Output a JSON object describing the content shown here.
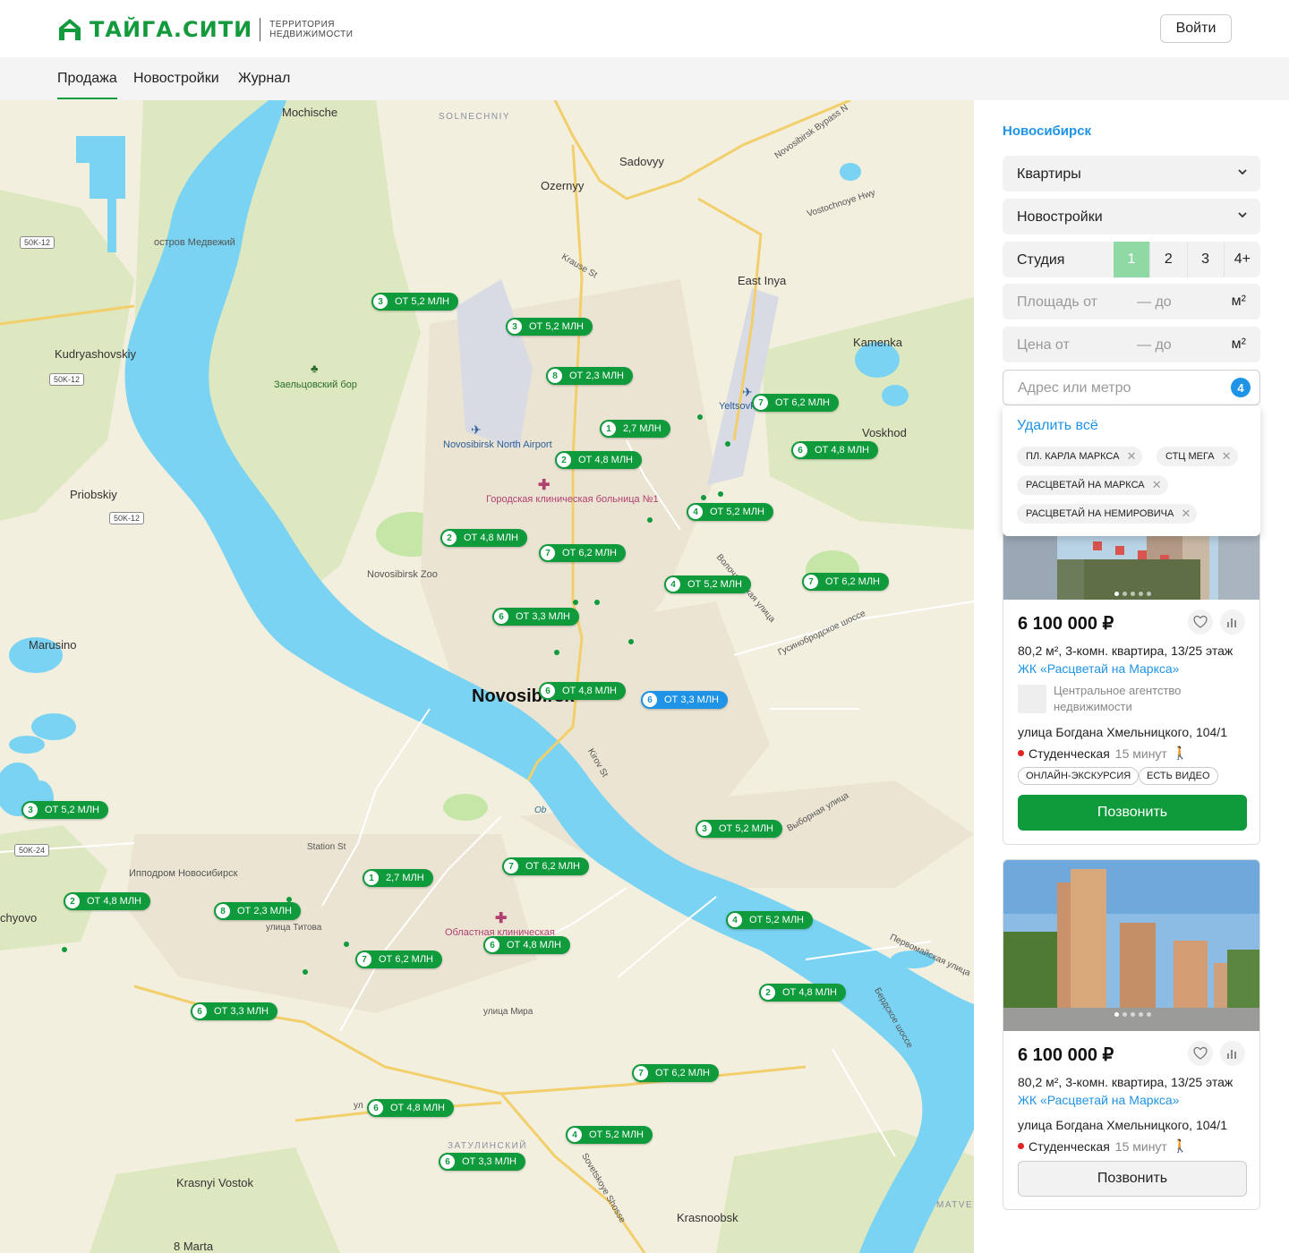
{
  "brand": {
    "name": "ТАЙГА.СИТИ",
    "tagline_1": "ТЕРРИТОРИЯ",
    "tagline_2": "НЕДВИЖИМОСТИ",
    "color": "#129a3c"
  },
  "header": {
    "login_label": "Войти"
  },
  "nav": {
    "items": [
      {
        "label": "Продажа",
        "active": true
      },
      {
        "label": "Новостройки"
      },
      {
        "label": "Журнал"
      }
    ]
  },
  "map": {
    "city_label": "Novosibirsk",
    "places": [
      "Mochische",
      "SOLNECHNIY",
      "Sadovyy",
      "Ozernyy",
      "East Inya",
      "Kamenka",
      "Kudryashovskiy",
      "остров Медвежий",
      "Заельцовский бор",
      "Novosibirsk North Airport",
      "Городская клиническая больница №1",
      "Yeltsovka Aerodrome",
      "Voskhod",
      "Priobskiy",
      "Novosibirsk Zoo",
      "Marusino",
      "Ob",
      "Station St",
      "Ипподром Новосибирск",
      "улица Титова",
      "Областная клиническая",
      "chyovo",
      "улица Мира",
      "ЗАТУЛИНСКИЙ",
      "Krasnyi Vostok",
      "Krasnoobsk",
      "8 Marta",
      "MATVEYEV",
      "Krause St",
      "Vostochnoye Hwy",
      "Novosibirsk Bypass N",
      "Волочаевская улица",
      "Гусинобродское шоссе",
      "Kirov St",
      "Выборная улица",
      "Первомайская улица",
      "Бердское шоссе",
      "Sovetskoye Shosse",
      "ул"
    ],
    "shields": [
      "50K-12",
      "50K-12",
      "50K-12",
      "50K-24"
    ],
    "pins": [
      {
        "n": "3",
        "label": "ОТ 5,2 МЛН"
      },
      {
        "n": "3",
        "label": "ОТ 5,2 МЛН"
      },
      {
        "n": "8",
        "label": "ОТ 2,3 МЛН"
      },
      {
        "n": "7",
        "label": "ОТ 6,2 МЛН"
      },
      {
        "n": "1",
        "label": "2,7 МЛН"
      },
      {
        "n": "6",
        "label": "ОТ 4,8 МЛН"
      },
      {
        "n": "2",
        "label": "ОТ 4,8 МЛН"
      },
      {
        "n": "4",
        "label": "ОТ 5,2 МЛН"
      },
      {
        "n": "2",
        "label": "ОТ 4,8 МЛН"
      },
      {
        "n": "7",
        "label": "ОТ 6,2 МЛН"
      },
      {
        "n": "4",
        "label": "ОТ 5,2 МЛН"
      },
      {
        "n": "7",
        "label": "ОТ 6,2 МЛН"
      },
      {
        "n": "6",
        "label": "ОТ 3,3 МЛН"
      },
      {
        "n": "6",
        "label": "ОТ 4,8 МЛН"
      },
      {
        "n": "6",
        "label": "ОТ 3,3 МЛН",
        "selected": true
      },
      {
        "n": "3",
        "label": "ОТ 5,2 МЛН"
      },
      {
        "n": "3",
        "label": "ОТ 5,2 МЛН"
      },
      {
        "n": "7",
        "label": "ОТ 6,2 МЛН"
      },
      {
        "n": "1",
        "label": "2,7 МЛН"
      },
      {
        "n": "2",
        "label": "ОТ 4,8 МЛН"
      },
      {
        "n": "8",
        "label": "ОТ 2,3 МЛН"
      },
      {
        "n": "4",
        "label": "ОТ 5,2 МЛН"
      },
      {
        "n": "6",
        "label": "ОТ 4,8 МЛН"
      },
      {
        "n": "7",
        "label": "ОТ 6,2 МЛН"
      },
      {
        "n": "2",
        "label": "ОТ 4,8 МЛН"
      },
      {
        "n": "6",
        "label": "ОТ 3,3 МЛН"
      },
      {
        "n": "7",
        "label": "ОТ 6,2 МЛН"
      },
      {
        "n": "6",
        "label": "ОТ 4,8 МЛН"
      },
      {
        "n": "4",
        "label": "ОТ 5,2 МЛН"
      },
      {
        "n": "6",
        "label": "ОТ 3,3 МЛН"
      }
    ],
    "colors": {
      "land": "#f2efdf",
      "water": "#7ad3f2",
      "park": "#c9e7ad",
      "road": "#f2cf6b"
    }
  },
  "filters": {
    "city": "Новосибирск",
    "type": "Квартиры",
    "market": "Новостройки",
    "rooms_label": "Студия",
    "rooms": [
      "1",
      "2",
      "3",
      "4+"
    ],
    "rooms_selected": "1",
    "area_from": "Площадь от",
    "area_to": "— до",
    "area_unit": "м²",
    "price_from": "Цена от",
    "price_to": "— до",
    "price_unit": "м²",
    "address_placeholder": "Адрес или метро",
    "address_count": "4",
    "clear_all": "Удалить всё",
    "chips": [
      "ПЛ. КАРЛА МАРКСА",
      "СТЦ МЕГА",
      "РАСЦВЕТАЙ НА МАРКСА",
      "РАСЦВЕТАЙ НА НЕМИРОВИЧА"
    ]
  },
  "listings": [
    {
      "price": "6 100 000 ₽",
      "desc": "80,2 м², 3-комн. квартира, 13/25 этаж",
      "complex": "ЖК «Расцветай на Маркса»",
      "agent": "Центральное агентство недвижимости",
      "address": "улица Богдана Хмельницкого, 104/1",
      "metro": "Студенческая",
      "metro_time": "15 минут",
      "tags": [
        "ОНЛАЙН-ЭКСКУРСИЯ",
        "ЕСТЬ ВИДЕО"
      ],
      "call": "Позвонить"
    },
    {
      "price": "6 100 000 ₽",
      "desc": "80,2 м², 3-комн. квартира, 13/25 этаж",
      "complex": "ЖК «Расцветай на Маркса»",
      "address": "улица Богдана Хмельницкого, 104/1",
      "metro": "Студенческая",
      "metro_time": "15 минут",
      "call": "Позвонить"
    }
  ]
}
